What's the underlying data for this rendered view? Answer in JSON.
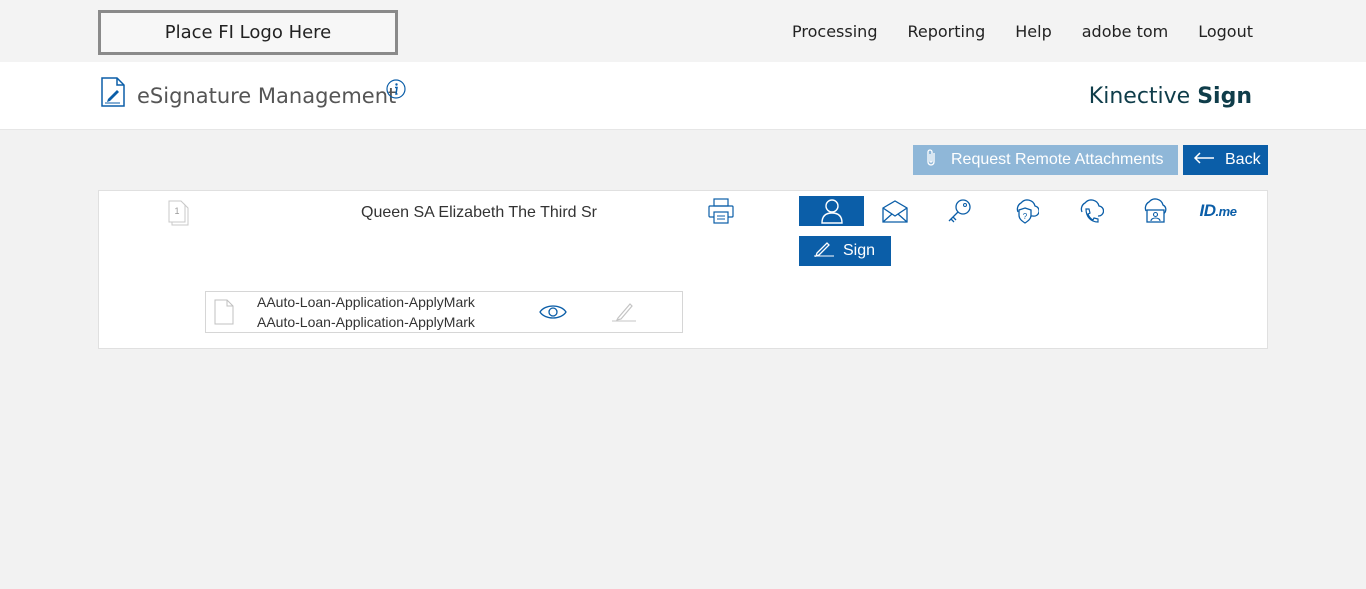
{
  "topbar": {
    "logo_text": "Place FI Logo Here",
    "nav": [
      {
        "label": "Processing"
      },
      {
        "label": "Reporting"
      },
      {
        "label": "Help"
      },
      {
        "label": "adobe tom"
      },
      {
        "label": "Logout"
      }
    ]
  },
  "header": {
    "title": "eSignature Management",
    "brand_prefix": "Kinective",
    "brand_bold": "Sign"
  },
  "actions": {
    "attach_label": "Request Remote Attachments",
    "back_label": "Back"
  },
  "record": {
    "signer_name": "Queen SA Elizabeth The Third Sr",
    "record_number": "1",
    "auth_icons": [
      "person-icon",
      "mail-icon",
      "key-icon",
      "shield-question-icon",
      "phone-icon",
      "id-card-icon",
      "idme-logo"
    ],
    "idme_text": "ID",
    "idme_suffix": ".me",
    "sign_label": "Sign",
    "document": {
      "name_line1": "AAuto-Loan-Application-ApplyMark",
      "name_line2": "AAuto-Loan-Application-ApplyMark"
    }
  },
  "colors": {
    "accent": "#0b5ea8",
    "accent_disabled": "#8fb7d8",
    "brand": "#0f3d4a",
    "background": "#f2f2f2"
  }
}
